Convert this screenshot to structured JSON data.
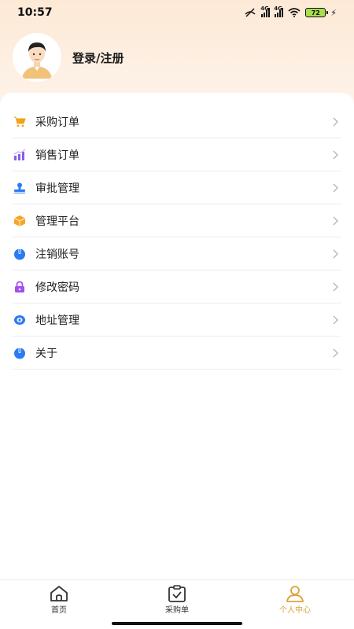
{
  "status_bar": {
    "time": "10:57",
    "network_1": "4G",
    "network_2": "4G",
    "battery": "72"
  },
  "profile": {
    "login_label": "登录/注册"
  },
  "menu": {
    "items": [
      {
        "label": "采购订单",
        "icon": "cart-icon",
        "color": "#f0a31c"
      },
      {
        "label": "销售订单",
        "icon": "chart-icon",
        "color": "#8a5cf0"
      },
      {
        "label": "审批管理",
        "icon": "stamp-icon",
        "color": "#2d7bf4"
      },
      {
        "label": "管理平台",
        "icon": "box-icon",
        "color": "#f5a623"
      },
      {
        "label": "注销账号",
        "icon": "logout-icon",
        "color": "#2d7bf4"
      },
      {
        "label": "修改密码",
        "icon": "lock-icon",
        "color": "#a44df0"
      },
      {
        "label": "地址管理",
        "icon": "location-icon",
        "color": "#2d7bf4"
      },
      {
        "label": "关于",
        "icon": "info-icon",
        "color": "#2d7bf4"
      }
    ]
  },
  "tabbar": {
    "tabs": [
      {
        "label": "首页",
        "icon": "home-icon",
        "active": false
      },
      {
        "label": "采购单",
        "icon": "clipboard-check-icon",
        "active": false
      },
      {
        "label": "个人中心",
        "icon": "user-icon",
        "active": true
      }
    ],
    "active_color": "#d9a437"
  }
}
